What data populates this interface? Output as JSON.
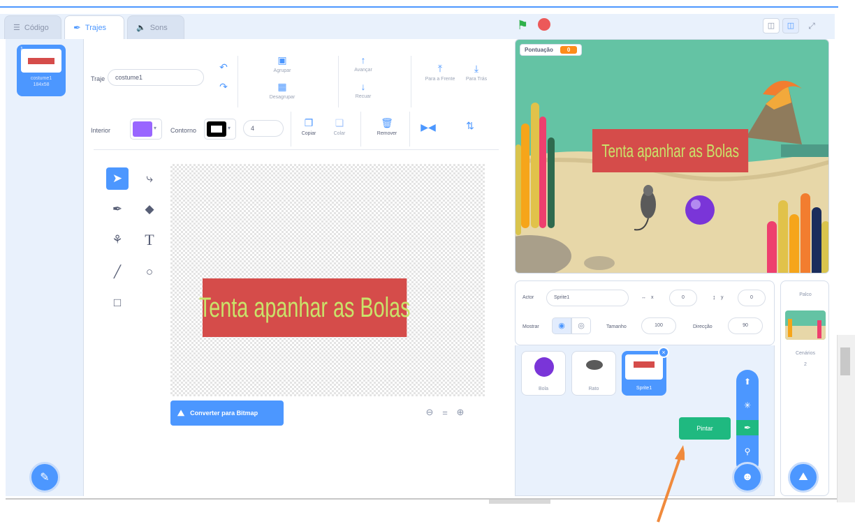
{
  "tabs": [
    {
      "label": "Código",
      "icon": "code-icon"
    },
    {
      "label": "Trajes",
      "icon": "brush-icon"
    },
    {
      "label": "Sons",
      "icon": "speaker-icon"
    }
  ],
  "costume_list": {
    "items": [
      {
        "number": "1",
        "name": "costume1",
        "size": "184x58"
      }
    ]
  },
  "editor": {
    "costume_label": "Traje",
    "costume_name": "costume1",
    "group_label": "Agrupar",
    "ungroup_label": "Desagrupar",
    "forward_label": "Avançar",
    "backward_label": "Recuar",
    "front_label": "Para a Frente",
    "back_label": "Para Trás",
    "fill_label": "Interior",
    "outline_label": "Contorno",
    "outline_width": "4",
    "copy_label": "Copiar",
    "paste_label": "Colar",
    "delete_label": "Remover",
    "canvas_text": "Tenta apanhar as Bolas",
    "convert_label": "Converter para Bitmap",
    "zoom_reset": "="
  },
  "stage": {
    "score_label": "Pontuação",
    "score_value": "0",
    "banner_text": "Tenta apanhar as Bolas"
  },
  "sprite_info": {
    "actor_label": "Actor",
    "actor_name": "Sprite1",
    "x_label": "x",
    "x_value": "0",
    "y_label": "y",
    "y_value": "0",
    "show_label": "Mostrar",
    "size_label": "Tamanho",
    "size_value": "100",
    "direction_label": "Direcção",
    "direction_value": "90"
  },
  "sprites": [
    {
      "name": "Bola"
    },
    {
      "name": "Rato"
    },
    {
      "name": "Sprite1"
    }
  ],
  "stage_pane": {
    "title": "Palco",
    "backdrops_label": "Cenários",
    "backdrops_count": "2"
  },
  "tooltip": "Pintar",
  "colors": {
    "accent": "#4c97ff",
    "fill": "#9966ff",
    "banner_bg": "#d54c4a",
    "banner_text": "#c9e36a",
    "tooltip_bg": "#1fb980",
    "arrow": "#f08a3c"
  }
}
